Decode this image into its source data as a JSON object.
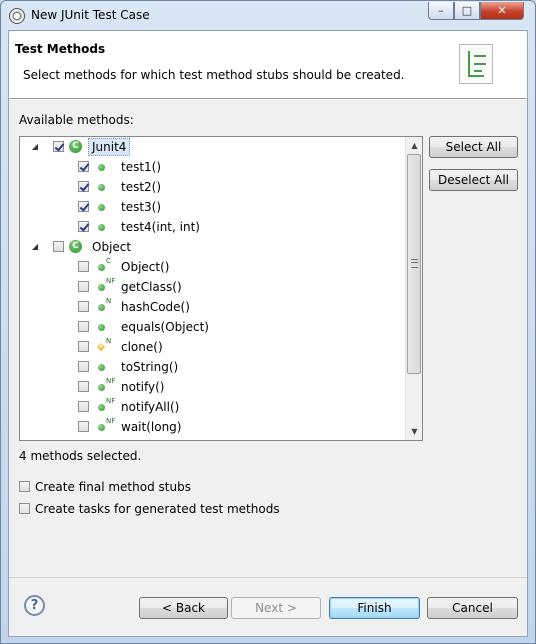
{
  "window": {
    "title": "New JUnit Test Case",
    "minimize_glyph": "–",
    "maximize_glyph": "□",
    "close_glyph": "✕"
  },
  "header": {
    "title": "Test Methods",
    "description": "Select methods for which test method stubs should be created."
  },
  "available_label": "Available methods:",
  "tree": {
    "groups": [
      {
        "label": "Junit4",
        "class_badge": "C",
        "checked": true,
        "selected": true,
        "methods": [
          {
            "label": "test1()",
            "checked": true,
            "overlay": ""
          },
          {
            "label": "test2()",
            "checked": true,
            "overlay": ""
          },
          {
            "label": "test3()",
            "checked": true,
            "overlay": ""
          },
          {
            "label": "test4(int, int)",
            "checked": true,
            "overlay": ""
          }
        ]
      },
      {
        "label": "Object",
        "class_badge": "C",
        "checked": false,
        "selected": false,
        "methods": [
          {
            "label": "Object()",
            "checked": false,
            "overlay": "C"
          },
          {
            "label": "getClass()",
            "checked": false,
            "overlay": "NF"
          },
          {
            "label": "hashCode()",
            "checked": false,
            "overlay": "N"
          },
          {
            "label": "equals(Object)",
            "checked": false,
            "overlay": ""
          },
          {
            "label": "clone()",
            "checked": false,
            "overlay": "N"
          },
          {
            "label": "toString()",
            "checked": false,
            "overlay": ""
          },
          {
            "label": "notify()",
            "checked": false,
            "overlay": "NF"
          },
          {
            "label": "notifyAll()",
            "checked": false,
            "overlay": "NF"
          },
          {
            "label": "wait(long)",
            "checked": false,
            "overlay": "NF"
          }
        ]
      }
    ],
    "expander_glyph": "◢",
    "scroll_up_glyph": "▲",
    "scroll_down_glyph": "▼"
  },
  "side_buttons": {
    "select_all": "Select All",
    "deselect_all": "Deselect All"
  },
  "status": "4 methods selected.",
  "options": {
    "final_stubs": {
      "label": "Create final method stubs",
      "checked": false
    },
    "tasks": {
      "label": "Create tasks for generated test methods",
      "checked": false
    }
  },
  "footer": {
    "help_glyph": "?",
    "back": "< Back",
    "next": "Next >",
    "finish": "Finish",
    "cancel": "Cancel"
  }
}
